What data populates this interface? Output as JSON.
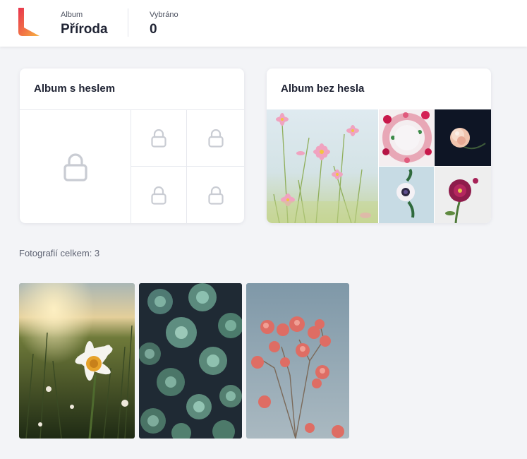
{
  "header": {
    "album_label": "Album",
    "album_name": "Příroda",
    "selected_label": "Vybráno",
    "selected_count": "0"
  },
  "cards": {
    "locked_title": "Album s heslem",
    "unlocked_title": "Album bez hesla"
  },
  "photos": {
    "count_text": "Fotografií celkem: 3"
  },
  "colors": {
    "logo_red": "#e8344e",
    "logo_orange": "#f6a443",
    "lock_gray": "#c9ccd3"
  },
  "icons": [
    "logo-icon",
    "lock-icon"
  ]
}
